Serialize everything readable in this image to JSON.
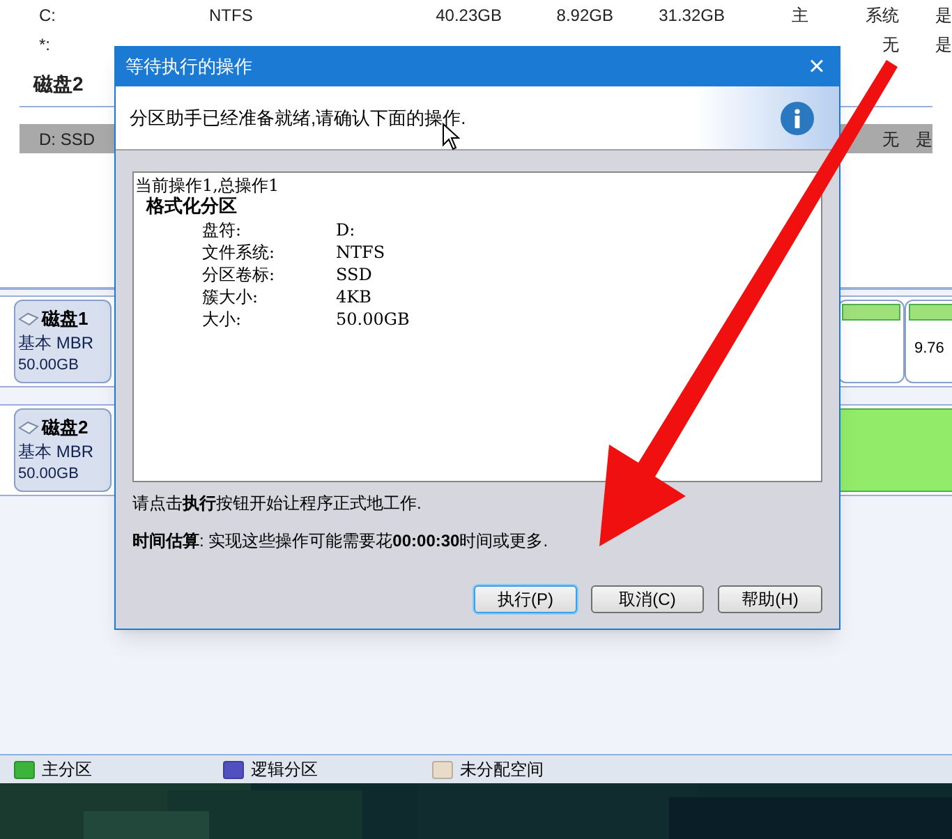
{
  "partition_table": {
    "rows": [
      {
        "selected": false,
        "cells": [
          "C:",
          "NTFS",
          "40.23GB",
          "8.92GB",
          "31.32GB",
          "主",
          "系统",
          "是"
        ]
      },
      {
        "selected": false,
        "cells": [
          "*:",
          null,
          null,
          null,
          null,
          null,
          "无",
          "是"
        ]
      },
      {
        "kind": "header",
        "cells": [
          "磁盘2"
        ]
      },
      {
        "selected": true,
        "cells": [
          "D: SSD",
          null,
          null,
          null,
          null,
          null,
          "无",
          "是"
        ]
      }
    ]
  },
  "disk_map": {
    "disks": [
      {
        "name": "磁盘1",
        "type": "基本 MBR",
        "size": "50.00GB",
        "partition_label": "9.76"
      },
      {
        "name": "磁盘2",
        "type": "基本 MBR",
        "size": "50.00GB"
      }
    ]
  },
  "legend": [
    {
      "label": "主分区",
      "color": "#3cb43c"
    },
    {
      "label": "逻辑分区",
      "color": "#5050c0"
    },
    {
      "label": "未分配空间",
      "color": "#e8dcc8"
    }
  ],
  "dialog": {
    "title": "等待执行的操作",
    "close": "×",
    "message": "分区助手已经准备就绪,请确认下面的操作.",
    "operation_header": "当前操作1,总操作1",
    "operation_title": "格式化分区",
    "details": [
      {
        "key": "盘符:",
        "value": "D:"
      },
      {
        "key": "文件系统:",
        "value": "NTFS"
      },
      {
        "key": "分区卷标:",
        "value": "SSD"
      },
      {
        "key": "簇大小:",
        "value": "4KB"
      },
      {
        "key": "大小:",
        "value": "50.00GB"
      }
    ],
    "instruction": "请点击**执行**按钮开始让程序正式地工作.",
    "estimate": "**时间估算**: 实现这些操作可能需要花**00:00:30**时间或更多.",
    "buttons": [
      {
        "label": "执行(P)",
        "focused": true
      },
      {
        "label": "取消(C)",
        "focused": false
      },
      {
        "label": "帮助(H)",
        "focused": false
      }
    ]
  }
}
